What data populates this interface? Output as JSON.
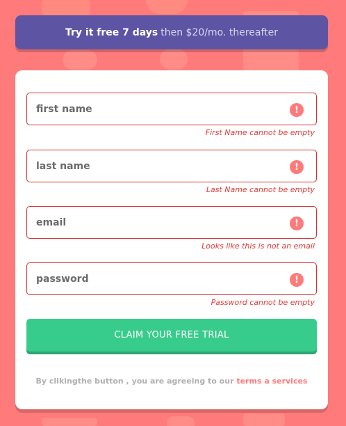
{
  "banner": {
    "strong_text": "Try it free 7 days",
    "light_text": "then $20/mo. thereafter"
  },
  "form": {
    "fields": [
      {
        "placeholder": "first name",
        "error": "First Name cannot be empty",
        "icon": "error-icon"
      },
      {
        "placeholder": "last name",
        "error": "Last Name cannot be empty",
        "icon": "error-icon"
      },
      {
        "placeholder": "email",
        "error": "Looks like this is not an email",
        "icon": "error-icon"
      },
      {
        "placeholder": "password",
        "error": "Password cannot be empty",
        "icon": "error-icon"
      }
    ],
    "error_glyph": "!",
    "submit_label": "CLAIM YOUR FREE TRIAL",
    "terms_prefix": "By clikingthe button , you are agreeing to our",
    "terms_link": "terms a services"
  },
  "colors": {
    "background": "#ff7a7a",
    "banner": "#5e54a4",
    "accent_green": "#38cc8c",
    "error_red": "#e53935"
  }
}
